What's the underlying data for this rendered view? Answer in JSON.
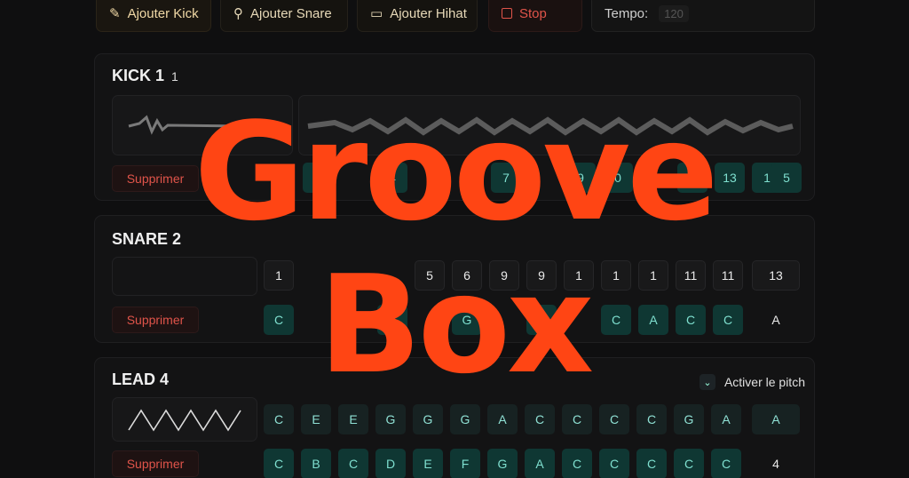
{
  "toolbar": {
    "add_kick": "Ajouter Kick",
    "add_snare": "Ajouter Snare",
    "add_hihat": "Ajouter Hihat",
    "stop": "Stop",
    "tempo_label": "Tempo:",
    "tempo_value": "120"
  },
  "kick": {
    "title": "KICK 1",
    "sub": "1",
    "delete": "Supprimer",
    "steps": [
      "2",
      "4",
      "7",
      "9",
      "0",
      "1",
      "13",
      "1",
      "5"
    ]
  },
  "snare": {
    "title": "SNARE 2",
    "delete": "Supprimer",
    "row1": [
      "1",
      "5",
      "6",
      "9",
      "9",
      "1",
      "1",
      "1",
      "11",
      "11",
      "13"
    ],
    "row2": [
      "C",
      "E",
      "G",
      "B",
      "C",
      "A",
      "C",
      "C",
      "A"
    ]
  },
  "lead": {
    "title": "LEAD 4",
    "pitch_toggle": "Activer le pitch",
    "delete": "Supprimer",
    "row1": [
      "C",
      "E",
      "E",
      "G",
      "G",
      "G",
      "A",
      "C",
      "C",
      "C",
      "C",
      "G",
      "A",
      "A"
    ],
    "row2": [
      "C",
      "B",
      "C",
      "D",
      "E",
      "F",
      "G",
      "A",
      "C",
      "C",
      "C",
      "C",
      "C",
      "4"
    ]
  },
  "overlay": {
    "line1": "Groove",
    "line2": "Box"
  },
  "colors": {
    "accent": "#ff4514",
    "teal_cell": "#0f3733",
    "delete": "#e0544a"
  }
}
